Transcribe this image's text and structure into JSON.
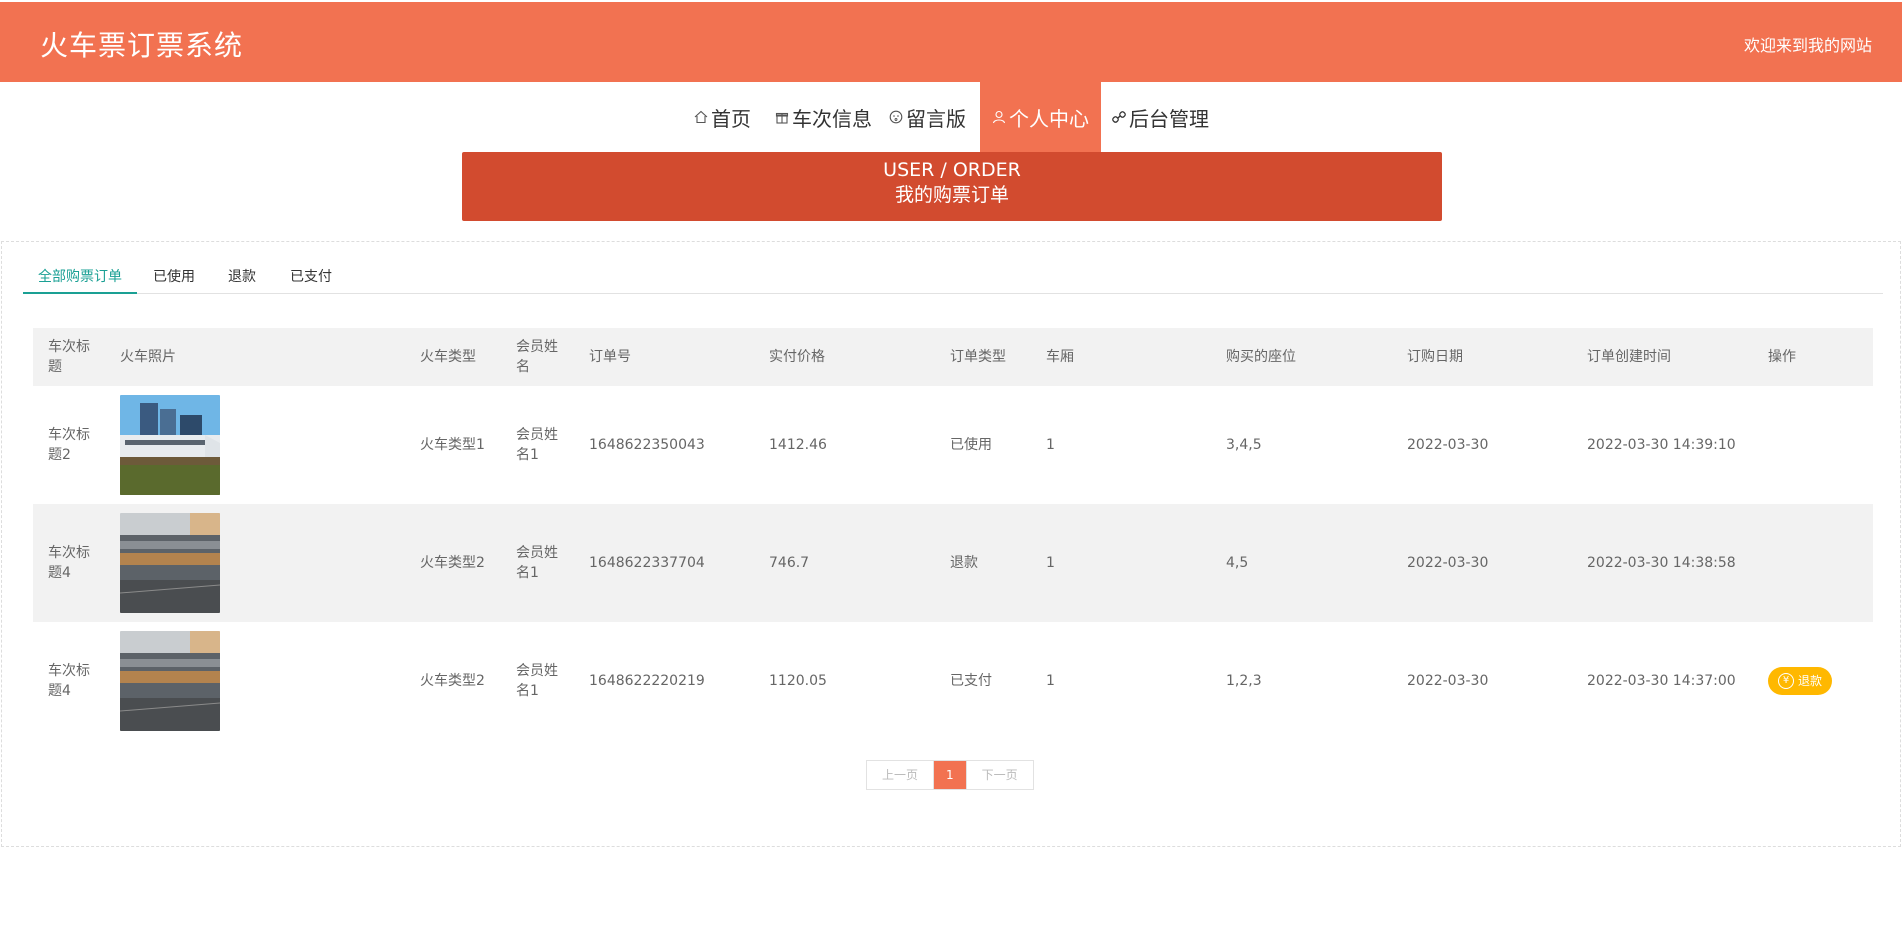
{
  "header": {
    "site_title": "火车票订票系统",
    "welcome": "欢迎来到我的网站",
    "brand_color": "#f27251"
  },
  "nav": {
    "items": [
      {
        "label": "首页",
        "icon": "home-icon"
      },
      {
        "label": "车次信息",
        "icon": "gift-icon"
      },
      {
        "label": "留言版",
        "icon": "face-icon"
      },
      {
        "label": "个人中心",
        "icon": "user-icon",
        "active": true
      },
      {
        "label": "后台管理",
        "icon": "link-icon"
      }
    ]
  },
  "banner": {
    "en": "USER / ORDER",
    "cn": "我的购票订单"
  },
  "tabs": [
    {
      "label": "全部购票订单",
      "active": true
    },
    {
      "label": "已使用"
    },
    {
      "label": "退款"
    },
    {
      "label": "已支付"
    }
  ],
  "table": {
    "headers": [
      "车次标题",
      "火车照片",
      "火车类型",
      "会员姓名",
      "订单号",
      "实付价格",
      "订单类型",
      "车厢",
      "购买的座位",
      "订购日期",
      "订单创建时间",
      "操作"
    ],
    "rows": [
      {
        "title": "车次标题2",
        "type": "火车类型1",
        "member": "会员姓名1",
        "order_no": "1648622350043",
        "price": "1412.46",
        "order_type": "已使用",
        "carriage": "1",
        "seats": "3,4,5",
        "date": "2022-03-30",
        "created": "2022-03-30 14:39:10",
        "action": ""
      },
      {
        "title": "车次标题4",
        "type": "火车类型2",
        "member": "会员姓名1",
        "order_no": "1648622337704",
        "price": "746.7",
        "order_type": "退款",
        "carriage": "1",
        "seats": "4,5",
        "date": "2022-03-30",
        "created": "2022-03-30 14:38:58",
        "action": ""
      },
      {
        "title": "车次标题4",
        "type": "火车类型2",
        "member": "会员姓名1",
        "order_no": "1648622220219",
        "price": "1120.05",
        "order_type": "已支付",
        "carriage": "1",
        "seats": "1,2,3",
        "date": "2022-03-30",
        "created": "2022-03-30 14:37:00",
        "action": "退款"
      }
    ]
  },
  "pager": {
    "prev": "上一页",
    "current": "1",
    "next": "下一页"
  }
}
